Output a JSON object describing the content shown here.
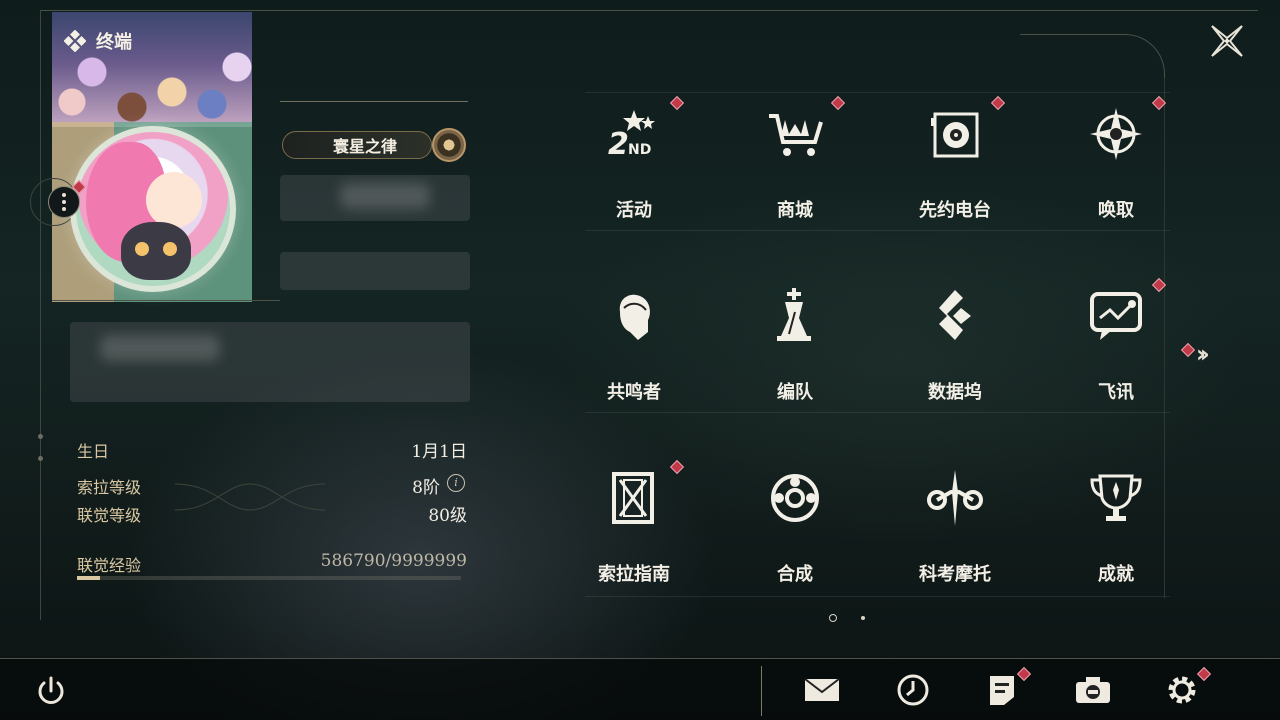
{
  "header": {
    "title": "终端",
    "close_icon": "close-icon"
  },
  "profile": {
    "avatar": "avatar",
    "title_badge": "寰星之律",
    "stats": [
      {
        "label": "生日",
        "value": "1月1日"
      },
      {
        "label": "索拉等级",
        "value": "8阶"
      },
      {
        "label": "联觉等级",
        "value": "80级"
      }
    ],
    "experience": {
      "label": "联觉经验",
      "value": "586790/9999999",
      "current": 586790,
      "max": 9999999
    }
  },
  "menu": {
    "items": [
      {
        "label": "活动",
        "icon": "event-2nd-icon",
        "badge": true
      },
      {
        "label": "商城",
        "icon": "shop-crown-cart-icon",
        "badge": true
      },
      {
        "label": "先约电台",
        "icon": "radio-icon",
        "badge": true
      },
      {
        "label": "唤取",
        "icon": "summon-compass-icon",
        "badge": true
      },
      {
        "label": "共鸣者",
        "icon": "resonator-portrait-icon",
        "badge": false
      },
      {
        "label": "编队",
        "icon": "team-chess-icon",
        "badge": false
      },
      {
        "label": "数据坞",
        "icon": "data-bank-icon",
        "badge": false
      },
      {
        "label": "飞讯",
        "icon": "message-bubble-icon",
        "badge": true
      },
      {
        "label": "索拉指南",
        "icon": "guide-book-icon",
        "badge": true
      },
      {
        "label": "合成",
        "icon": "synthesis-icon",
        "badge": false
      },
      {
        "label": "科考摩托",
        "icon": "motorcycle-icon",
        "badge": false
      },
      {
        "label": "成就",
        "icon": "trophy-icon",
        "badge": false
      }
    ],
    "next_page_icon": "double-chevron-right-icon",
    "pages": 2,
    "current_page": 1
  },
  "bottom_bar": {
    "items": [
      {
        "name": "mail-button",
        "icon": "mail-icon",
        "badge": false
      },
      {
        "name": "history-button",
        "icon": "clock-icon",
        "badge": false
      },
      {
        "name": "notes-button",
        "icon": "notes-icon",
        "badge": true
      },
      {
        "name": "camera-button",
        "icon": "camera-icon",
        "badge": false
      },
      {
        "name": "settings-button",
        "icon": "gear-icon",
        "badge": true
      }
    ],
    "power_icon": "power-icon"
  },
  "colors": {
    "accent_gold": "#d9c8a2",
    "badge_red": "#c23a4a",
    "text": "#f2efe6"
  }
}
